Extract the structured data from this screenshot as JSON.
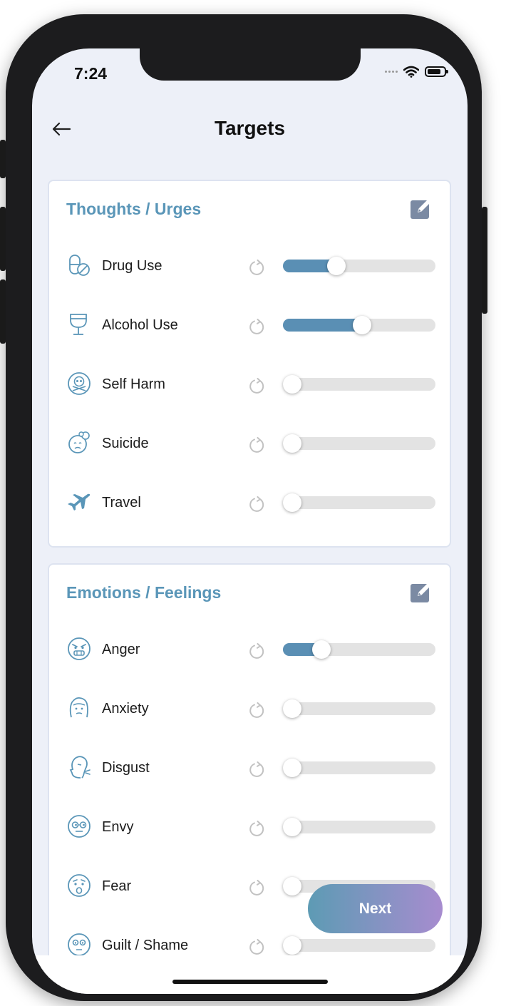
{
  "status_bar": {
    "time": "7:24"
  },
  "header": {
    "title": "Targets"
  },
  "sections": [
    {
      "title": "Thoughts / Urges",
      "items": [
        {
          "label": "Drug Use",
          "icon": "pill-icon",
          "value": 0.33
        },
        {
          "label": "Alcohol Use",
          "icon": "wine-glass-icon",
          "value": 0.52
        },
        {
          "label": "Self Harm",
          "icon": "skull-icon",
          "value": 0.0
        },
        {
          "label": "Suicide",
          "icon": "sad-face-icon",
          "value": 0.0
        },
        {
          "label": "Travel",
          "icon": "airplane-icon",
          "value": 0.0
        }
      ]
    },
    {
      "title": "Emotions / Feelings",
      "items": [
        {
          "label": "Anger",
          "icon": "angry-face-icon",
          "value": 0.22
        },
        {
          "label": "Anxiety",
          "icon": "anxious-face-icon",
          "value": 0.0
        },
        {
          "label": "Disgust",
          "icon": "disgust-face-icon",
          "value": 0.0
        },
        {
          "label": "Envy",
          "icon": "envy-face-icon",
          "value": 0.0
        },
        {
          "label": "Fear",
          "icon": "fear-face-icon",
          "value": 0.0
        },
        {
          "label": "Guilt / Shame",
          "icon": "guilt-face-icon",
          "value": 0.0
        }
      ]
    }
  ],
  "next_button": {
    "label": "Next"
  },
  "colors": {
    "accent": "#5a96b8",
    "slider_fill": "#5a8fb4",
    "button_gradient_start": "#5d9bb4",
    "button_gradient_end": "#a78ccf"
  }
}
